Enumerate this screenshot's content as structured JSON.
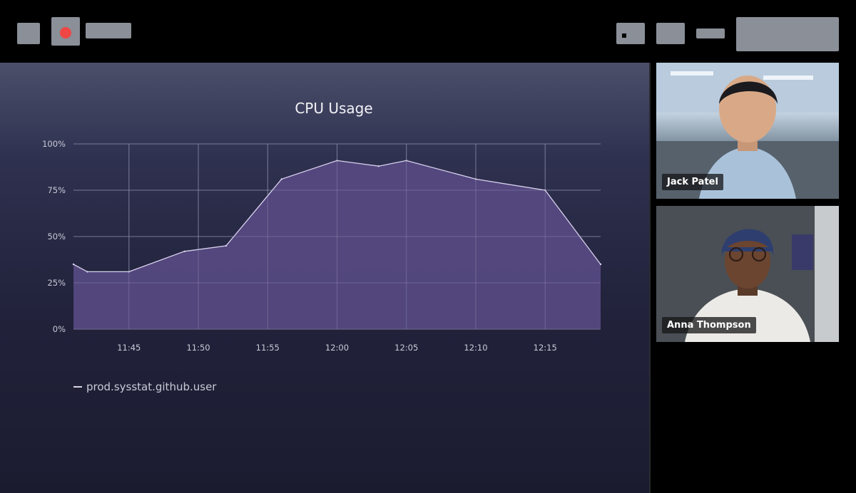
{
  "chart_data": {
    "type": "area",
    "title": "CPU Usage",
    "x": [
      "11:41",
      "11:42",
      "11:45",
      "11:49",
      "11:52",
      "11:56",
      "12:00",
      "12:03",
      "12:05",
      "12:10",
      "12:15",
      "12:19"
    ],
    "y_ticks": [
      "0%",
      "25%",
      "50%",
      "75%",
      "100%"
    ],
    "x_ticks": [
      "11:45",
      "11:50",
      "11:55",
      "12:00",
      "12:05",
      "12:10",
      "12:15"
    ],
    "series": [
      {
        "name": "prod.sysstat.github.user",
        "values": [
          35,
          31,
          31,
          42,
          45,
          81,
          91,
          88,
          91,
          81,
          75,
          35
        ]
      }
    ],
    "ylim": [
      0,
      100
    ],
    "grid": true,
    "legend_position": "bottom-left",
    "fill_color": "#574a82",
    "line_color": "#d8d2ee"
  },
  "participants": [
    {
      "name": "Jack Patel"
    },
    {
      "name": "Anna Thompson"
    }
  ],
  "colors": {
    "record": "#ef4646"
  }
}
